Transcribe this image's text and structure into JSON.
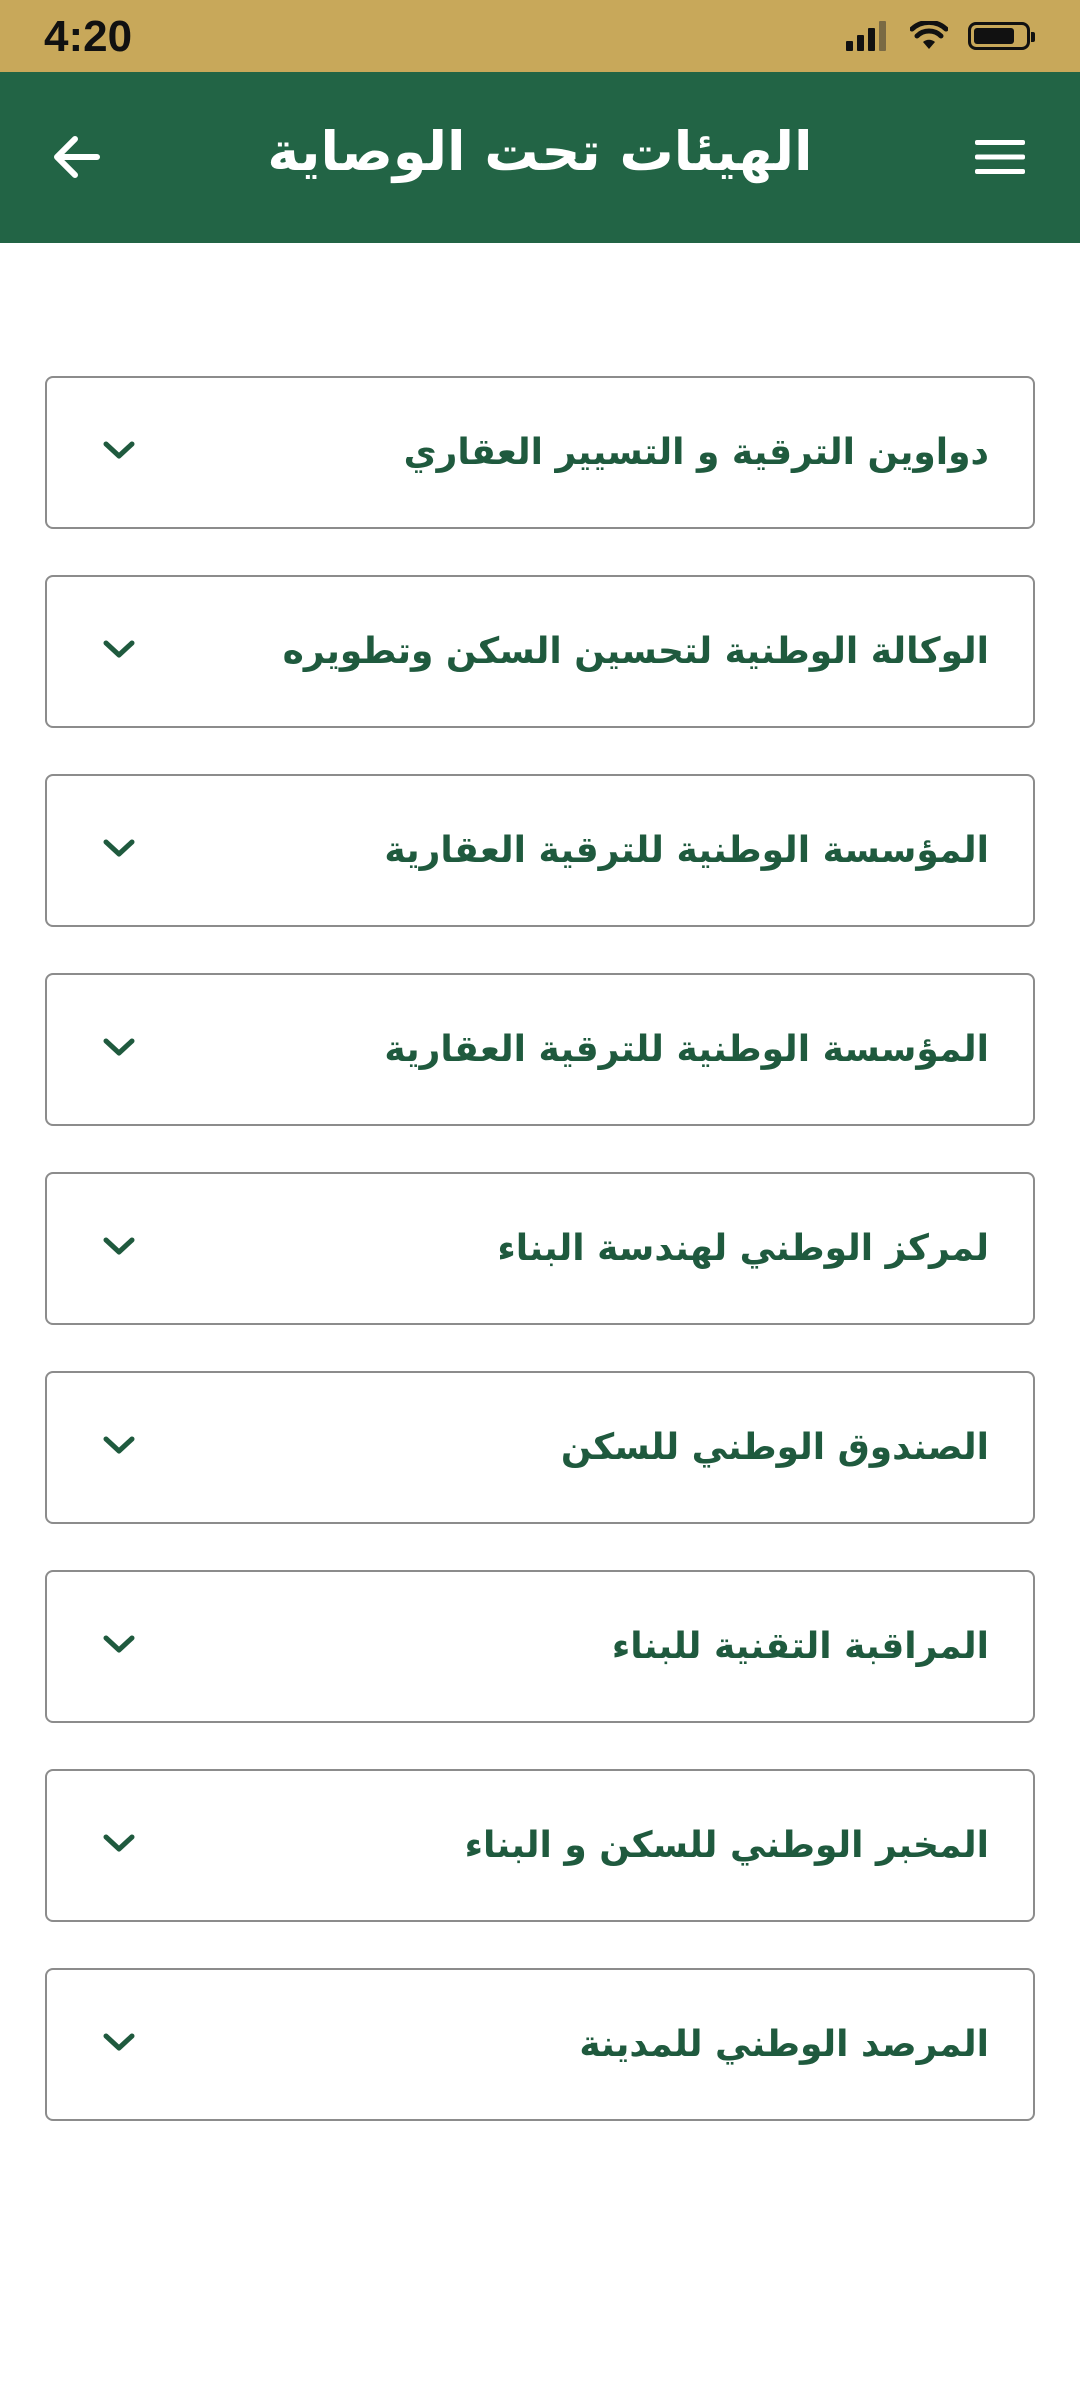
{
  "status_bar": {
    "time": "4:20",
    "background_color": "#c8a85a",
    "icons": [
      "cellular-signal-icon",
      "wifi-icon",
      "battery-icon"
    ]
  },
  "header": {
    "title": "الهيئات تحت الوصاية",
    "background_color": "#226445",
    "menu_icon": "hamburger-menu-icon",
    "back_icon": "arrow-left-icon"
  },
  "accent_text_color": "#1f5a3e",
  "items": [
    {
      "label": "دواوين الترقية و التسيير العقاري"
    },
    {
      "label": "الوكالة الوطنية لتحسين السكن وتطويره"
    },
    {
      "label": "المؤسسة الوطنية للترقية العقارية"
    },
    {
      "label": "المؤسسة الوطنية للترقية العقارية"
    },
    {
      "label": "لمركز الوطني لهندسة البناء"
    },
    {
      "label": "الصندوق الوطني للسكن"
    },
    {
      "label": "المراقبة التقنية للبناء"
    },
    {
      "label": "المخبر الوطني للسكن و البناء"
    },
    {
      "label": "المرصد الوطني للمدينة"
    }
  ]
}
